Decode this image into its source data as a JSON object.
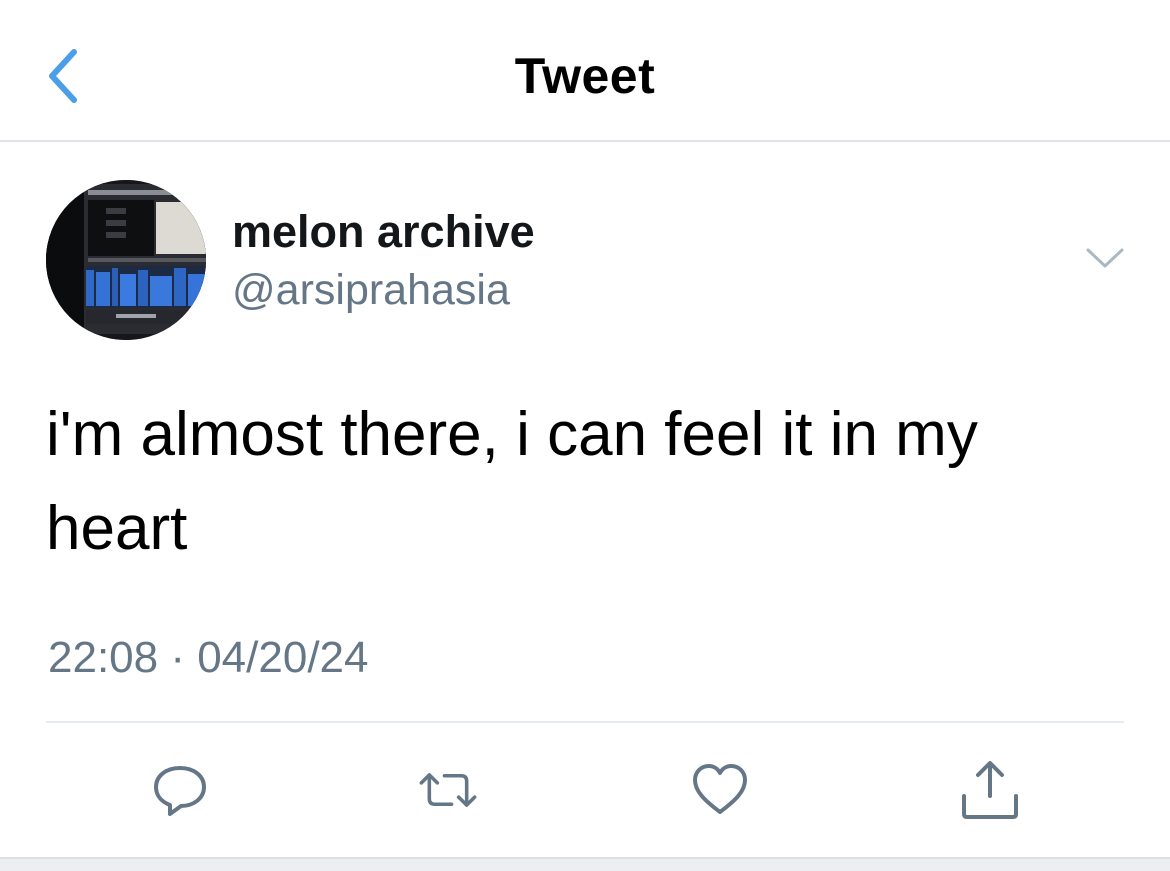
{
  "header": {
    "title": "Tweet",
    "back_icon": "chevron-left-icon",
    "accent_color": "#4a9fe8"
  },
  "tweet": {
    "author": {
      "display_name": "melon archive",
      "handle": "@arsiprahasia",
      "avatar_icon": "profile-photo-video-editor-screen"
    },
    "more_icon": "chevron-down-icon",
    "text": "i'm almost there, i can feel it in my heart",
    "timestamp": "22:08 · 04/20/24"
  },
  "actions": [
    {
      "name": "reply",
      "icon": "reply-icon"
    },
    {
      "name": "retweet",
      "icon": "retweet-icon"
    },
    {
      "name": "like",
      "icon": "heart-icon"
    },
    {
      "name": "share",
      "icon": "share-icon"
    }
  ],
  "colors": {
    "text_primary": "#14171a",
    "text_secondary": "#657786",
    "icon_gray": "#657786",
    "divider": "#e6ecf0"
  }
}
